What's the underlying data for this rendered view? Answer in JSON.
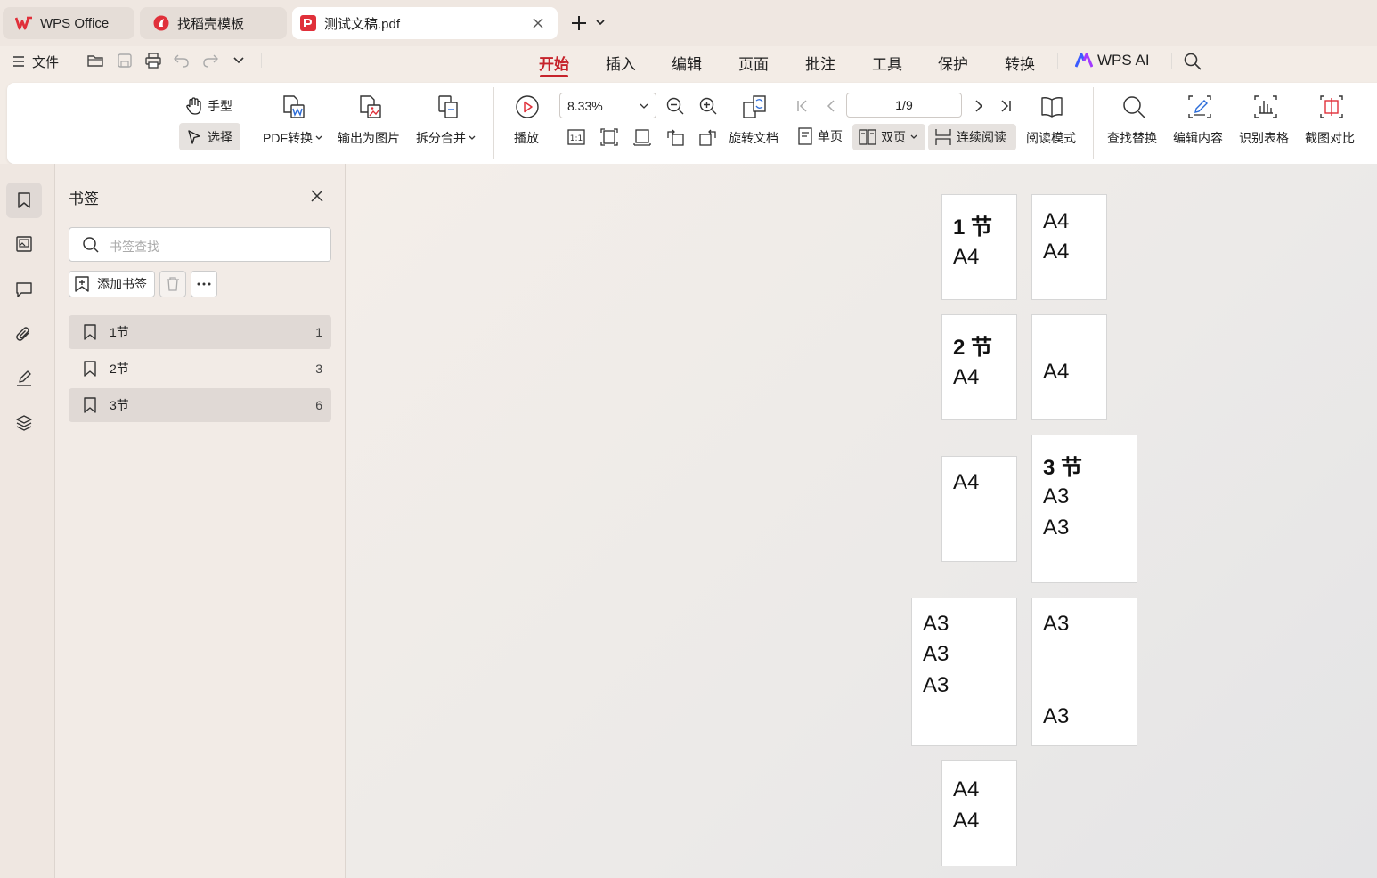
{
  "tabs": [
    {
      "label": "WPS Office",
      "icon": "wps-logo-icon"
    },
    {
      "label": "找稻壳模板",
      "icon": "docer-icon"
    },
    {
      "label": "测试文稿.pdf",
      "icon": "pdf-icon"
    }
  ],
  "menu": {
    "file_label": "文件",
    "tabs": [
      "开始",
      "插入",
      "编辑",
      "页面",
      "批注",
      "工具",
      "保护",
      "转换"
    ],
    "active_tab": "开始",
    "ai_label": "WPS AI"
  },
  "ribbon": {
    "hand": "手型",
    "select": "选择",
    "pdf_convert": "PDF转换",
    "export_image": "输出为图片",
    "split_merge": "拆分合并",
    "play": "播放",
    "zoom_value": "8.33%",
    "rotate_doc": "旋转文档",
    "single_page": "单页",
    "double_page": "双页",
    "continuous": "连续阅读",
    "read_mode": "阅读模式",
    "page_value": "1/9",
    "find_replace": "查找替换",
    "edit_content": "编辑内容",
    "recognize_table": "识别表格",
    "screenshot_compare": "截图对比"
  },
  "bookmarks": {
    "title": "书签",
    "search_placeholder": "书签查找",
    "add_label": "添加书签",
    "items": [
      {
        "label": "1节",
        "page": "1"
      },
      {
        "label": "2节",
        "page": "3"
      },
      {
        "label": "3节",
        "page": "6"
      }
    ]
  },
  "pages": [
    {
      "lines": [
        "1 节",
        "A4"
      ]
    },
    {
      "lines": [
        "A4",
        "A4"
      ]
    },
    {
      "lines": [
        "2 节",
        "A4"
      ]
    },
    {
      "lines": [
        "A4"
      ]
    },
    {
      "lines": [
        "A4"
      ]
    },
    {
      "lines": [
        "3 节",
        "A3",
        "A3"
      ]
    },
    {
      "lines": [
        "A3",
        "A3",
        "A3"
      ]
    },
    {
      "lines": [
        "A3",
        "A3"
      ]
    },
    {
      "lines": [
        "A4",
        "A4"
      ]
    }
  ],
  "colors": {
    "accent": "#c6232b",
    "pdf_red": "#e0303a",
    "ai_blue": "#3b5bff"
  }
}
